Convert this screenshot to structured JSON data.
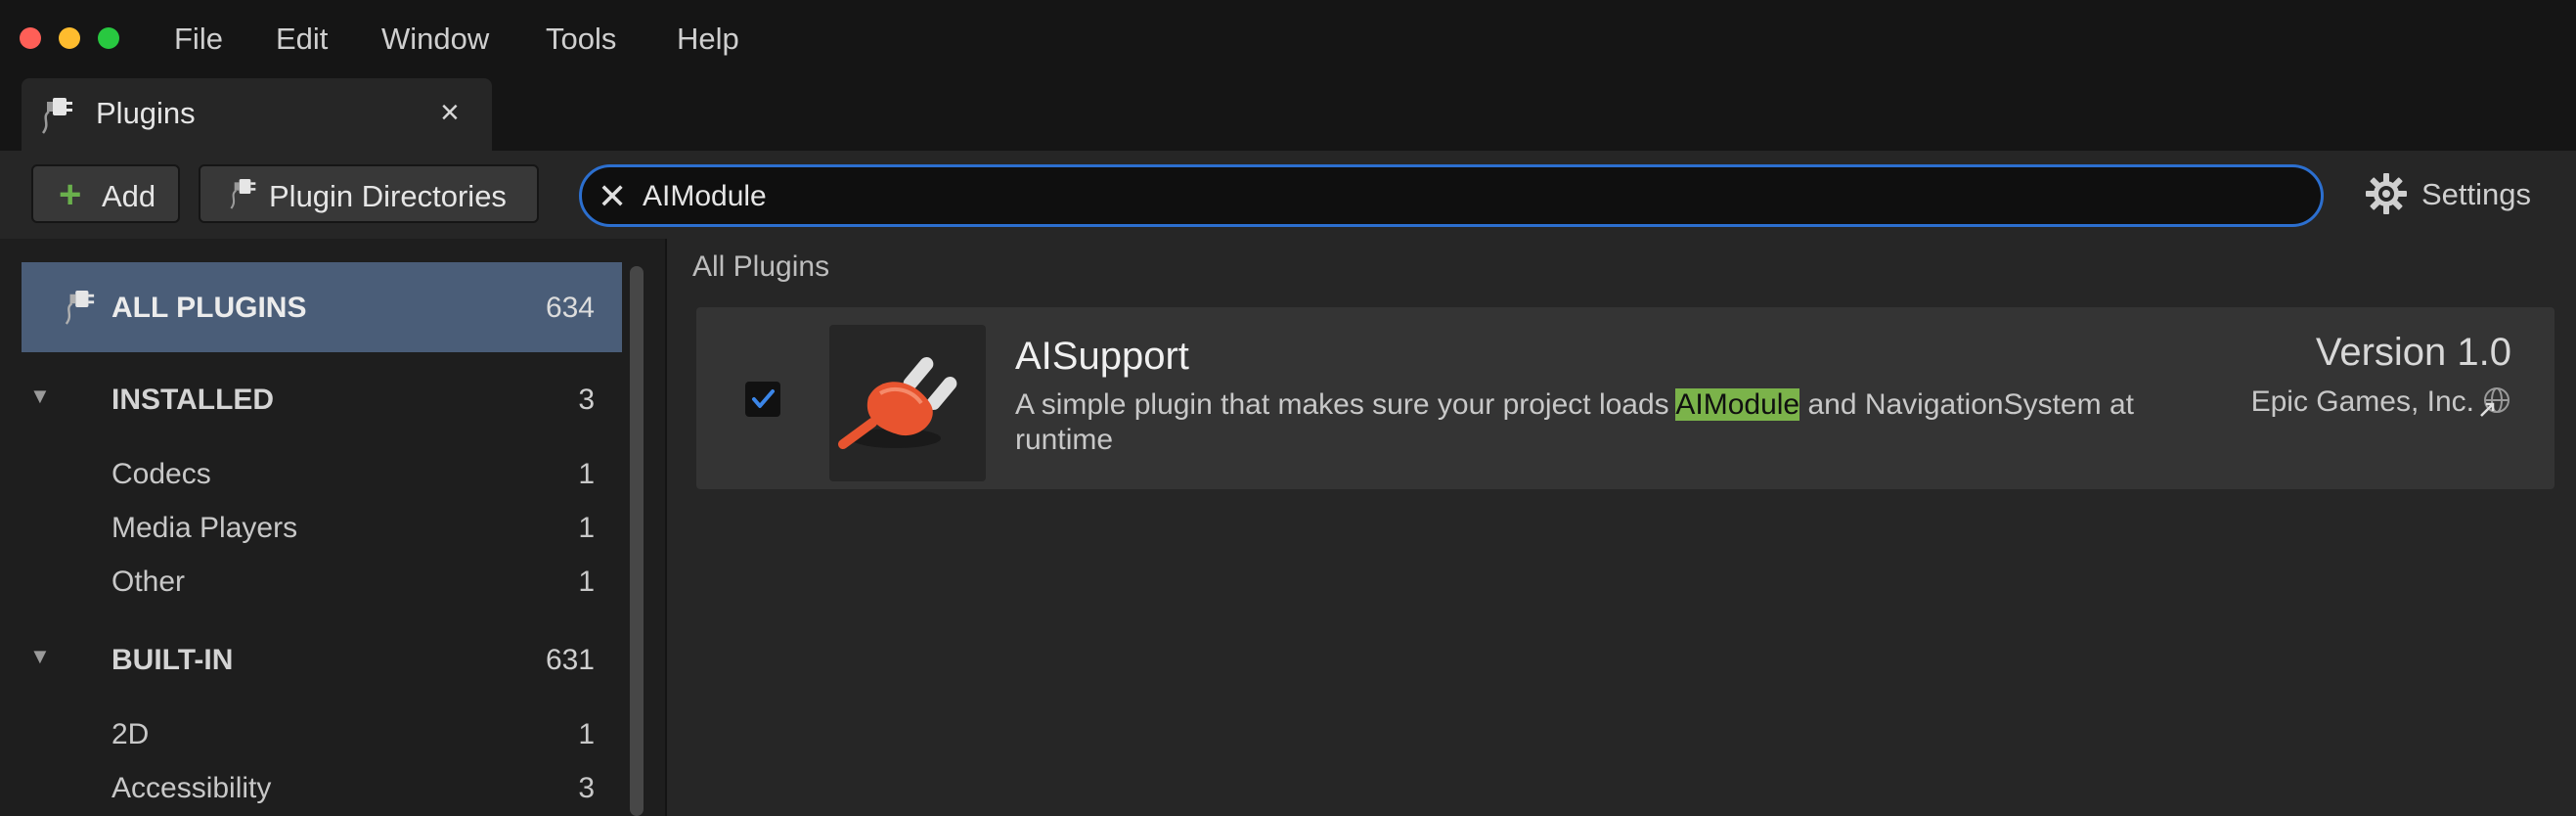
{
  "menu": [
    "File",
    "Edit",
    "Window",
    "Tools",
    "Help"
  ],
  "tab": {
    "label": "Plugins",
    "close": "×"
  },
  "toolbar": {
    "add_label": "Add",
    "plugin_directories_label": "Plugin Directories",
    "search_value": "AIModule",
    "settings_label": "Settings"
  },
  "sidebar": {
    "all": {
      "label": "ALL PLUGINS",
      "count": "634"
    },
    "groups": [
      {
        "label": "INSTALLED",
        "count": "3",
        "items": [
          {
            "label": "Codecs",
            "count": "1"
          },
          {
            "label": "Media Players",
            "count": "1"
          },
          {
            "label": "Other",
            "count": "1"
          }
        ]
      },
      {
        "label": "BUILT-IN",
        "count": "631",
        "items": [
          {
            "label": "2D",
            "count": "1"
          },
          {
            "label": "Accessibility",
            "count": "3"
          }
        ]
      }
    ]
  },
  "main": {
    "title": "All Plugins",
    "plugin": {
      "name": "AISupport",
      "enabled": true,
      "desc_before": "A simple plugin that makes sure your project loads ",
      "desc_highlight": "AIModule",
      "desc_after": " and NavigationSystem at runtime",
      "version": "Version 1.0",
      "vendor": "Epic Games, Inc."
    }
  },
  "colors": {
    "accent": "#2c6fcf",
    "selection": "#4a5d78",
    "highlight": "#7bb34a",
    "plug": "#e8542f"
  }
}
